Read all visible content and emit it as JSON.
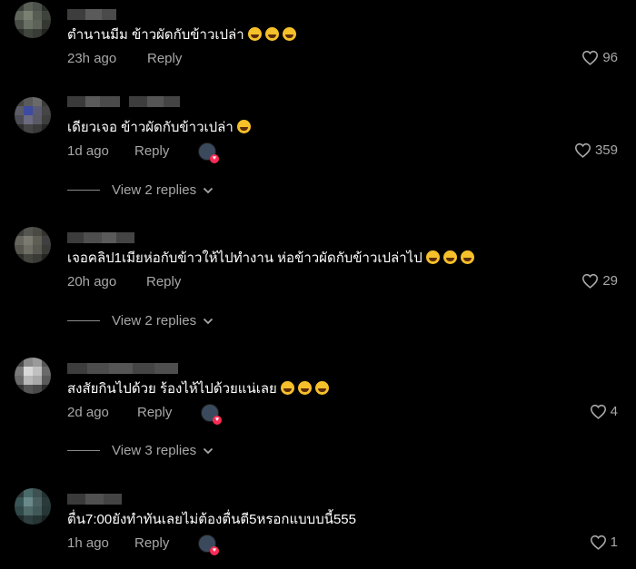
{
  "ui": {
    "reply_label": "Reply",
    "colors": {
      "background": "#000000",
      "text_primary": "#ffffff",
      "text_secondary": "#a8a8a8",
      "accent_heart": "#fe2c55"
    }
  },
  "comments": [
    {
      "text": "ตำนานมีม ข้าวผัดกับข้าวเปล่า",
      "emojis": [
        "grinning-sweat-emoji",
        "grinning-sweat-emoji",
        "grinning-sweat-emoji"
      ],
      "time": "23h ago",
      "reply": "Reply",
      "likes": "96",
      "creator_liked": false,
      "view_replies": null
    },
    {
      "text": "เดียวเจอ ข้าวผัดกับข้าวเปล่า",
      "emojis": [
        "rofl-emoji"
      ],
      "time": "1d ago",
      "reply": "Reply",
      "likes": "359",
      "creator_liked": true,
      "view_replies": "View 2 replies"
    },
    {
      "text": "เจอคลิป1เมียห่อกับข้าวให้ไปทำงาน ห่อข้าวผัดกับข้าวเปล่าไป",
      "emojis": [
        "grinning-sweat-emoji",
        "grinning-sweat-emoji",
        "grinning-sweat-emoji"
      ],
      "time": "20h ago",
      "reply": "Reply",
      "likes": "29",
      "creator_liked": false,
      "view_replies": "View 2 replies"
    },
    {
      "text": "สงสัยกินไปด้วย ร้องไห้ไปด้วยแน่เลย",
      "emojis": [
        "rofl-emoji",
        "rofl-emoji",
        "rofl-emoji"
      ],
      "time": "2d ago",
      "reply": "Reply",
      "likes": "4",
      "creator_liked": true,
      "view_replies": "View 3 replies"
    },
    {
      "text": "ตื่น7:00ยังทำทันเลยไม่ต้องตื่นตี5หรอกแบบบนี้555",
      "emojis": [],
      "time": "1h ago",
      "reply": "Reply",
      "likes": "1",
      "creator_liked": true,
      "view_replies": null
    }
  ]
}
